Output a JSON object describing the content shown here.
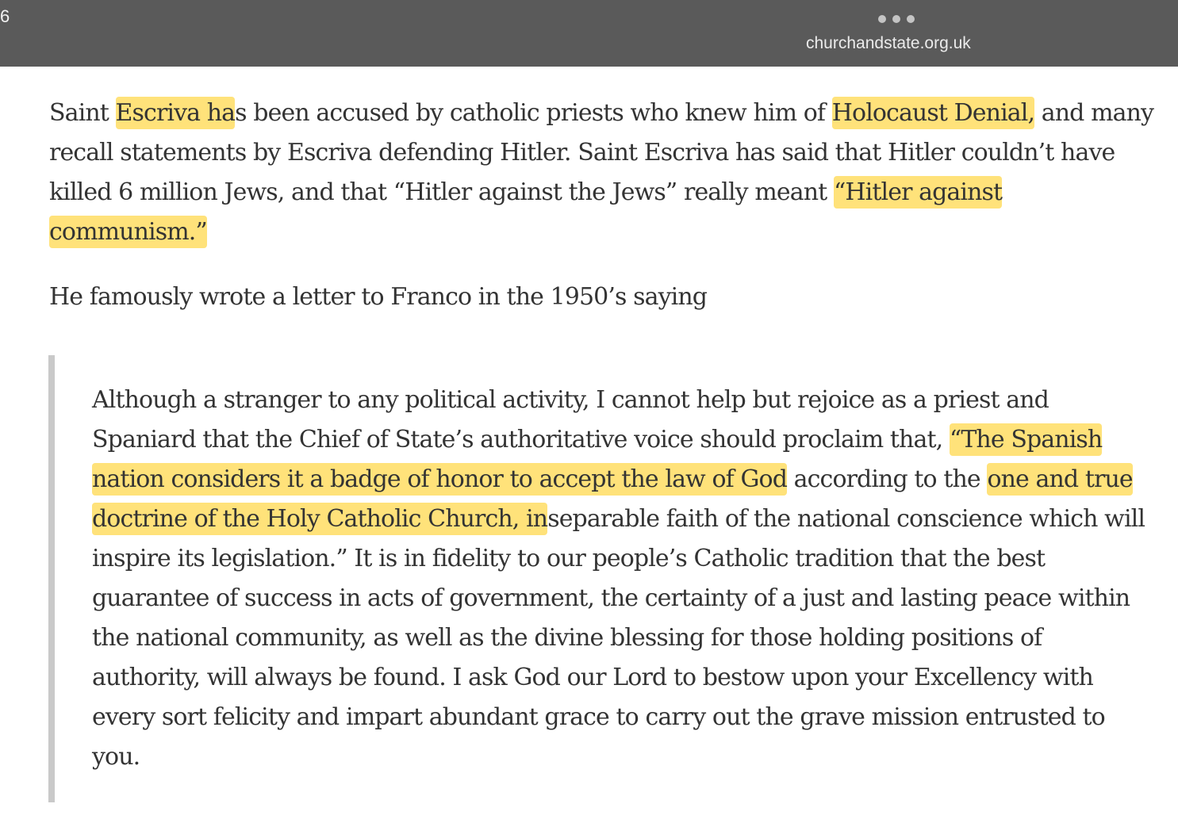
{
  "browser": {
    "corner_number": "6",
    "url": "churchandstate.org.uk",
    "more_icon": "ellipsis-icon"
  },
  "article": {
    "p1": {
      "s1": "Saint ",
      "h1": "Escriva ha",
      "s2": "s been accused by catholic priests who knew him of ",
      "h2": "Holocaust Denial,",
      "s3": " and many recall statements by Escriva defending Hitler. Saint Escriva has said that Hitler couldn’t have killed 6 million Jews, and that “Hitler against the Jews” really meant ",
      "h3": "“Hitler against communism.”"
    },
    "p2": "He famously wrote a letter to Franco in the 1950’s saying",
    "quote": {
      "s1": "Although a stranger to any political activity, I cannot help but rejoice as a priest and Spaniard that the Chief of State’s authoritative voice should proclaim that, ",
      "h1": "“The Spanish nation considers it a badge of honor to accept the law of God",
      "s2": " according to the ",
      "h2": "one and true doctrine of the Holy Catholic Church, in",
      "s3": "separable faith of the national conscience which will inspire its legislation.” It is in fidelity to our people’s Catholic tradition that the best guarantee of success in acts of government, the certainty of a just and lasting peace within the national community, as well as the divine blessing for those holding positions of authority, will always be found. I ask God our Lord to bestow upon your Excellency with every sort felicity and impart abundant grace to carry out the grave mission entrusted to you."
    }
  },
  "colors": {
    "highlight": "#ffe27a",
    "topbar": "#5a5a5a",
    "quote_bar": "#c9c9c9",
    "text": "#333333"
  }
}
